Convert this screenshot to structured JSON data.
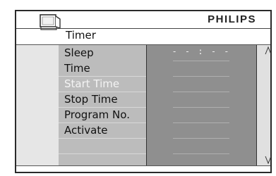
{
  "header": {
    "brand": "PHILIPS",
    "title": "Timer",
    "icon": "tv-icon"
  },
  "menu": {
    "items": [
      {
        "label": "Sleep",
        "selected": false
      },
      {
        "label": "Time",
        "selected": false
      },
      {
        "label": "Start Time",
        "selected": true
      },
      {
        "label": "Stop Time",
        "selected": false
      },
      {
        "label": "Program No.",
        "selected": false
      },
      {
        "label": "Activate",
        "selected": false
      }
    ]
  },
  "value_panel": {
    "value": "- - : - -"
  },
  "scrollbar": {
    "up_icon": "scroll-up-icon",
    "down_icon": "scroll-down-icon"
  },
  "colors": {
    "menu_bg": "#bcbcbc",
    "value_bg": "#8f8f8f",
    "selected_text": "#f4f4f4"
  }
}
